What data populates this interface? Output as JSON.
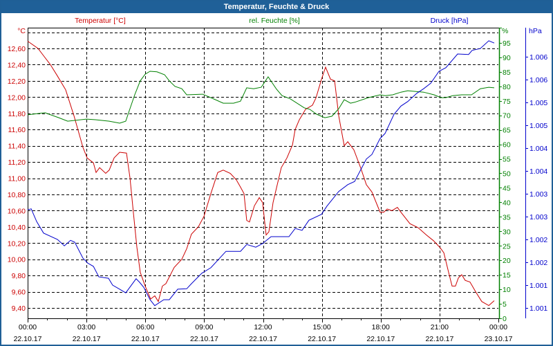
{
  "window": {
    "title": "Temperatur, Feuchte & Druck"
  },
  "chart_data": {
    "type": "line",
    "title": "Temperatur, Feuchte & Druck",
    "colors": {
      "temperature": "#cc0000",
      "humidity": "#008000",
      "pressure": "#0000cc"
    },
    "legend": {
      "temperature": "Temperatur [°C]",
      "humidity": "rel. Feuchte [%]",
      "pressure": "Druck [hPa]"
    },
    "x_axis": {
      "range_hours": [
        0,
        24
      ],
      "ticks": [
        {
          "time": "00:00",
          "date": "22.10.17"
        },
        {
          "time": "03:00",
          "date": "22.10.17"
        },
        {
          "time": "06:00",
          "date": "22.10.17"
        },
        {
          "time": "09:00",
          "date": "22.10.17"
        },
        {
          "time": "12:00",
          "date": "22.10.17"
        },
        {
          "time": "15:00",
          "date": "22.10.17"
        },
        {
          "time": "18:00",
          "date": "22.10.17"
        },
        {
          "time": "21:00",
          "date": "22.10.17"
        },
        {
          "time": "00:00",
          "date": "23.10.17"
        }
      ]
    },
    "y_left": {
      "unit": "°C",
      "range": [
        9.27,
        12.85
      ],
      "ticks": [
        "12,60",
        "12,40",
        "12,20",
        "12,00",
        "11,80",
        "11,60",
        "11,40",
        "11,20",
        "11,00",
        "10,80",
        "10,60",
        "10,40",
        "10,20",
        "10,00",
        "9,80",
        "9,60",
        "9,40"
      ],
      "tick_values": [
        12.6,
        12.4,
        12.2,
        12.0,
        11.8,
        11.6,
        11.4,
        11.2,
        11.0,
        10.8,
        10.6,
        10.4,
        10.2,
        10.0,
        9.8,
        9.6,
        9.4
      ],
      "grid_values": [
        12.8,
        12.6,
        12.4,
        12.2,
        12.0,
        11.8,
        11.6,
        11.4,
        11.2,
        11.0,
        10.8,
        10.6,
        10.4,
        10.2,
        10.0,
        9.8,
        9.6,
        9.4
      ]
    },
    "y_right": {
      "unit": "%",
      "range": [
        0,
        100
      ],
      "ticks": [
        "95",
        "90",
        "85",
        "80",
        "75",
        "70",
        "65",
        "60",
        "55",
        "50",
        "45",
        "40",
        "35",
        "30",
        "25",
        "20",
        "15",
        "10",
        "5",
        "0"
      ],
      "tick_values": [
        95,
        90,
        85,
        80,
        75,
        70,
        65,
        60,
        55,
        50,
        45,
        40,
        35,
        30,
        25,
        20,
        15,
        10,
        5,
        0
      ]
    },
    "y_right2": {
      "unit": "hPa",
      "ticks": [
        "1.006",
        "1.006",
        "1.005",
        "1.005",
        "1.004",
        "1.004",
        "1.003",
        "1.003",
        "1.002",
        "1.002",
        "1.001",
        "1.001"
      ],
      "tick_values": [
        1006.1,
        1005.6,
        1005.1,
        1004.6,
        1004.1,
        1003.6,
        1003.1,
        1002.6,
        1002.1,
        1001.6,
        1001.1,
        1000.6
      ]
    },
    "grid": true,
    "series": [
      {
        "name": "Temperatur [°C]",
        "axis": "left",
        "x": [
          0,
          0.53,
          0.81,
          1.16,
          1.52,
          1.94,
          2.36,
          2.82,
          3.03,
          3.35,
          3.49,
          3.67,
          3.98,
          4.16,
          4.41,
          4.69,
          5.04,
          5.22,
          5.39,
          5.57,
          5.74,
          5.99,
          6.27,
          6.48,
          6.66,
          6.87,
          7.05,
          7.47,
          7.86,
          8.11,
          8.35,
          8.7,
          8.99,
          9.34,
          9.69,
          9.97,
          10.33,
          10.64,
          10.85,
          11.03,
          11.17,
          11.31,
          11.56,
          11.81,
          11.98,
          12.16,
          12.3,
          12.51,
          12.93,
          13.22,
          13.5,
          13.64,
          13.85,
          14.17,
          14.52,
          14.7,
          14.98,
          15.19,
          15.44,
          15.65,
          15.86,
          16.14,
          16.32,
          16.63,
          16.99,
          17.27,
          17.55,
          17.97,
          18.15,
          18.33,
          18.57,
          18.85,
          19.03,
          19.49,
          19.91,
          20.33,
          20.69,
          21.04,
          21.22,
          21.43,
          21.64,
          21.81,
          21.96,
          22.13,
          22.31,
          22.55,
          22.84,
          23.15,
          23.51,
          23.79
        ],
        "y": [
          12.69,
          12.6,
          12.51,
          12.4,
          12.26,
          12.09,
          11.77,
          11.38,
          11.25,
          11.19,
          11.07,
          11.13,
          11.06,
          11.1,
          11.25,
          11.32,
          11.31,
          11.0,
          10.58,
          10.15,
          9.84,
          9.67,
          9.51,
          9.55,
          9.48,
          9.67,
          9.7,
          9.9,
          10.0,
          10.13,
          10.31,
          10.4,
          10.53,
          10.81,
          11.07,
          11.1,
          11.06,
          10.98,
          10.89,
          10.81,
          10.48,
          10.46,
          10.66,
          10.76,
          10.7,
          10.3,
          10.34,
          10.7,
          11.13,
          11.25,
          11.41,
          11.6,
          11.72,
          11.85,
          11.9,
          11.99,
          12.22,
          12.37,
          12.22,
          12.2,
          11.77,
          11.4,
          11.45,
          11.35,
          11.12,
          10.92,
          10.83,
          10.58,
          10.58,
          10.62,
          10.6,
          10.64,
          10.58,
          10.44,
          10.39,
          10.3,
          10.23,
          10.14,
          10.08,
          9.87,
          9.67,
          9.67,
          9.77,
          9.81,
          9.74,
          9.72,
          9.6,
          9.48,
          9.43,
          9.49
        ]
      },
      {
        "name": "rel. Feuchte [%]",
        "axis": "right",
        "x": [
          0,
          0.88,
          1.59,
          2.04,
          3.0,
          3.45,
          4.16,
          4.69,
          5.0,
          5.18,
          5.46,
          5.74,
          5.99,
          6.24,
          6.59,
          6.98,
          7.22,
          7.51,
          7.86,
          8.11,
          8.92,
          9.41,
          9.97,
          10.5,
          10.85,
          11.17,
          11.52,
          11.91,
          12.26,
          12.69,
          12.97,
          13.39,
          14.1,
          14.38,
          14.73,
          15.15,
          15.51,
          15.86,
          16.14,
          16.46,
          16.67,
          17.37,
          17.97,
          18.22,
          18.61,
          19.03,
          19.38,
          20.19,
          20.72,
          21.07,
          21.32,
          21.67,
          22.13,
          22.63,
          23.08,
          23.51,
          23.79
        ],
        "y": [
          70.2,
          70.9,
          69.2,
          68.0,
          68.7,
          68.5,
          68.0,
          67.3,
          68.0,
          71.6,
          77.1,
          81.9,
          84.2,
          85.2,
          85.0,
          84.0,
          81.9,
          80.0,
          79.2,
          77.1,
          77.3,
          75.9,
          74.2,
          74.2,
          74.9,
          79.5,
          79.2,
          79.7,
          83.3,
          79.0,
          76.8,
          75.7,
          72.6,
          72.1,
          70.4,
          69.2,
          69.7,
          72.3,
          75.4,
          74.2,
          74.5,
          76.1,
          77.1,
          76.8,
          77.1,
          78.0,
          78.5,
          78.0,
          77.1,
          76.1,
          76.1,
          76.8,
          77.1,
          77.1,
          79.2,
          79.7,
          79.5
        ]
      },
      {
        "name": "Druck [hPa]",
        "axis": "right2",
        "x": [
          0,
          0.18,
          0.46,
          0.81,
          1.52,
          1.87,
          2.19,
          2.4,
          2.82,
          3.07,
          3.35,
          3.63,
          4.12,
          4.33,
          4.69,
          5.0,
          5.53,
          5.71,
          5.92,
          6.24,
          6.48,
          6.94,
          7.22,
          7.65,
          8.11,
          8.35,
          8.88,
          9.34,
          10.11,
          10.85,
          11.17,
          11.63,
          11.98,
          12.41,
          13.32,
          13.64,
          13.99,
          14.34,
          14.98,
          15.26,
          15.86,
          16.32,
          16.67,
          17.27,
          17.55,
          17.97,
          18.22,
          18.68,
          19.03,
          19.38,
          19.84,
          20.19,
          20.55,
          20.97,
          21.32,
          21.92,
          22.48,
          22.66,
          23.08,
          23.51,
          23.79
        ],
        "y": [
          1002.75,
          1002.77,
          1002.49,
          1002.24,
          1002.1,
          1001.96,
          1002.08,
          1002.04,
          1001.69,
          1001.58,
          1001.51,
          1001.28,
          1001.25,
          1001.1,
          1001.01,
          1000.93,
          1001.24,
          1001.16,
          1001.05,
          1000.78,
          1000.65,
          1000.78,
          1000.78,
          1001.01,
          1001.02,
          1001.13,
          1001.36,
          1001.48,
          1001.84,
          1001.84,
          1001.99,
          1001.93,
          1002.01,
          1002.16,
          1002.16,
          1002.34,
          1002.3,
          1002.52,
          1002.65,
          1002.83,
          1003.15,
          1003.3,
          1003.37,
          1003.86,
          1003.96,
          1004.31,
          1004.42,
          1004.84,
          1005.02,
          1005.12,
          1005.3,
          1005.4,
          1005.52,
          1005.78,
          1005.86,
          1006.16,
          1006.15,
          1006.24,
          1006.28,
          1006.45,
          1006.4
        ]
      }
    ]
  }
}
